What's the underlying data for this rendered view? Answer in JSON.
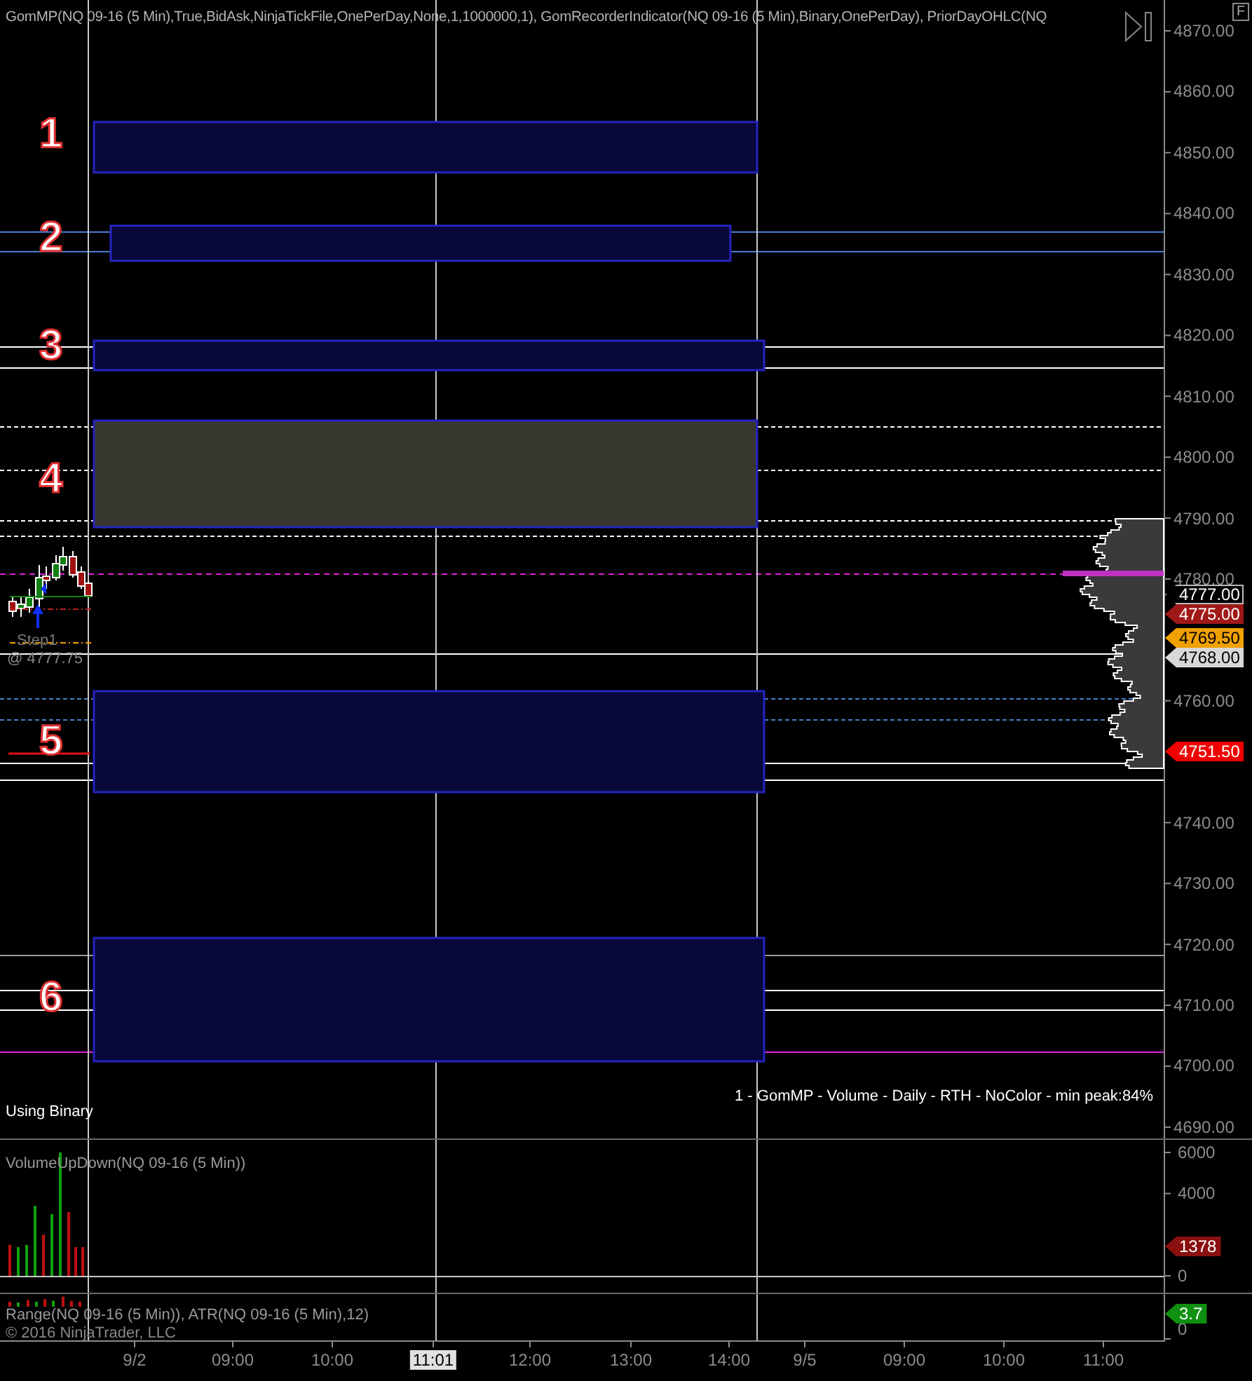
{
  "header": "GomMP(NQ 09-16 (5 Min),True,BidAsk,NinjaTickFile,OnePerDay,None,1,1000000,1), GomRecorderIndicator(NQ 09-16 (5 Min),Binary,OnePerDay), PriorDayOHLC(NQ",
  "f_button": "F",
  "price_axis": [
    "4870.00",
    "4860.00",
    "4850.00",
    "4840.00",
    "4830.00",
    "4820.00",
    "4810.00",
    "4800.00",
    "4790.00",
    "4780.00",
    "4760.00",
    "4740.00",
    "4730.00",
    "4720.00",
    "4710.00",
    "4700.00",
    "4690.00"
  ],
  "zones": [
    {
      "number": "1",
      "color": "#08083a"
    },
    {
      "number": "2",
      "color": "#08083a"
    },
    {
      "number": "3",
      "color": "#08083a"
    },
    {
      "number": "4",
      "color": "#38372f"
    },
    {
      "number": "5",
      "color": "#08083a"
    },
    {
      "number": "6",
      "color": "#08083a"
    }
  ],
  "price_tags": [
    {
      "text": "4777.00",
      "color": "#000000"
    },
    {
      "text": "4775.00",
      "color": "#a01818"
    },
    {
      "text": "4769.50",
      "color": "#f0a000"
    },
    {
      "text": "4768.00",
      "color": "#d8d8d8"
    },
    {
      "text": "4751.50",
      "color": "#f00000"
    }
  ],
  "marker": {
    "label": "Step1",
    "price": "@ 4777.75"
  },
  "status_left": "Using Binary",
  "status_right": "1 - GomMP - Volume - Daily - RTH - NoColor - min peak:84%",
  "volume_panel": {
    "title": "VolumeUpDown(NQ 09-16 (5 Min))",
    "axis": [
      "6000",
      "4000",
      "0"
    ],
    "tag": {
      "text": "1378",
      "color": "#8a1010"
    }
  },
  "range_panel": {
    "title": "Range(NQ 09-16 (5 Min)), ATR(NQ 09-16 (5 Min),12)",
    "copyright": "© 2016 NinjaTrader, LLC",
    "axis": [
      "0"
    ],
    "tag": {
      "text": "3.7",
      "color": "#109010"
    }
  },
  "time_axis": [
    {
      "label": "9/2",
      "selected": false
    },
    {
      "label": "09:00",
      "selected": false
    },
    {
      "label": "10:00",
      "selected": false
    },
    {
      "label": "11:01",
      "selected": true
    },
    {
      "label": "12:00",
      "selected": false
    },
    {
      "label": "13:00",
      "selected": false
    },
    {
      "label": "14:00",
      "selected": false
    },
    {
      "label": "9/5",
      "selected": false
    },
    {
      "label": "09:00",
      "selected": false
    },
    {
      "label": "10:00",
      "selected": false
    },
    {
      "label": "11:00",
      "selected": false
    }
  ]
}
